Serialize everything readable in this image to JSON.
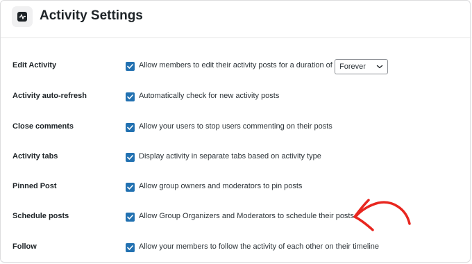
{
  "header": {
    "title": "Activity Settings",
    "icon": "activity-icon"
  },
  "settings": [
    {
      "label": "Edit Activity",
      "text": "Allow members to edit their activity posts for a duration of",
      "checked": true
    },
    {
      "label": "Activity auto-refresh",
      "text": "Automatically check for new activity posts",
      "checked": true
    },
    {
      "label": "Close comments",
      "text": "Allow your users to stop users commenting on their posts",
      "checked": true
    },
    {
      "label": "Activity tabs",
      "text": "Display activity in separate tabs based on activity type",
      "checked": true
    },
    {
      "label": "Pinned Post",
      "text": "Allow group owners and moderators to pin posts",
      "checked": true
    },
    {
      "label": "Schedule posts",
      "text": "Allow Group Organizers and Moderators to schedule their posts",
      "checked": true
    },
    {
      "label": "Follow",
      "text": "Allow your members to follow the activity of each other on their timeline",
      "checked": true
    }
  ],
  "edit_duration": {
    "selected": "Forever"
  },
  "colors": {
    "checkbox": "#2271b1",
    "annotation_arrow": "#e8261f",
    "text": "#1d2327"
  }
}
